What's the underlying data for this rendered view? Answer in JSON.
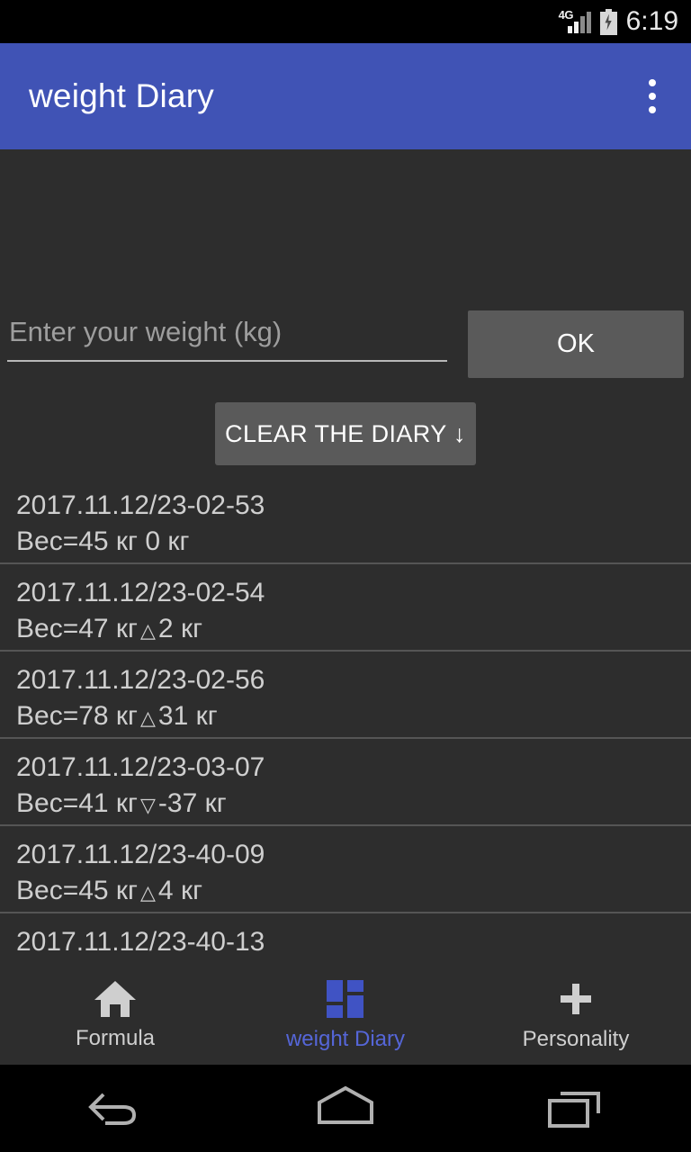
{
  "status_bar": {
    "network_label": "4G",
    "time": "6:19",
    "signal_icon": "signal-bars-icon",
    "battery_icon": "battery-charging-icon"
  },
  "app_bar": {
    "title": "weight Diary",
    "overflow_icon": "overflow-menu-icon",
    "background_color": "#4053b5"
  },
  "form": {
    "input_placeholder": "Enter your weight (kg)",
    "input_value": "",
    "ok_label": "OK",
    "clear_label": "CLEAR THE DIARY ↓"
  },
  "diary": {
    "rows": [
      {
        "timestamp": "2017.11.12/23-02-53",
        "weight": "Вес=45 кг",
        "arrow": "",
        "delta": "0 кг"
      },
      {
        "timestamp": "2017.11.12/23-02-54",
        "weight": "Вес=47 кг",
        "arrow": "△",
        "delta": "2 кг"
      },
      {
        "timestamp": "2017.11.12/23-02-56",
        "weight": "Вес=78 кг",
        "arrow": "△",
        "delta": "31 кг"
      },
      {
        "timestamp": "2017.11.12/23-03-07",
        "weight": "Вес=41 кг",
        "arrow": "▽",
        "delta": "-37 кг"
      },
      {
        "timestamp": "2017.11.12/23-40-09",
        "weight": "Вес=45 кг",
        "arrow": "△",
        "delta": "4 кг"
      },
      {
        "timestamp": "2017.11.12/23-40-13",
        "weight": "",
        "arrow": "",
        "delta": ""
      }
    ]
  },
  "bottom_nav": {
    "active_color": "#5566d8",
    "items": [
      {
        "label": "Formula",
        "icon": "home-icon",
        "active": false
      },
      {
        "label": "weight Diary",
        "icon": "dashboard-grid-icon",
        "active": true
      },
      {
        "label": "Personality",
        "icon": "plus-icon",
        "active": false
      }
    ]
  },
  "android_nav": {
    "back_icon": "back-arrow-icon",
    "home_icon": "home-pentagon-icon",
    "recents_icon": "recent-apps-icon"
  }
}
